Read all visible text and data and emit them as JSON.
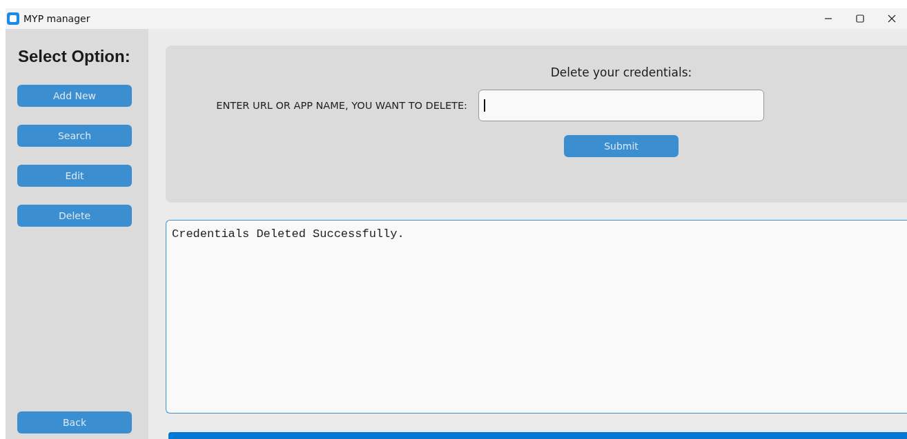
{
  "window": {
    "title": "MYP manager"
  },
  "sidebar": {
    "title": "Select Option:",
    "buttons": [
      "Add New",
      "Search",
      "Edit",
      "Delete"
    ],
    "back_button": "Back"
  },
  "form": {
    "heading": "Delete your credentials:",
    "label": "ENTER URL OR APP NAME, YOU WANT TO DELETE:",
    "focused": true,
    "submit": "Submit"
  },
  "output": {
    "text": "Credentials Deleted Successfully."
  }
}
